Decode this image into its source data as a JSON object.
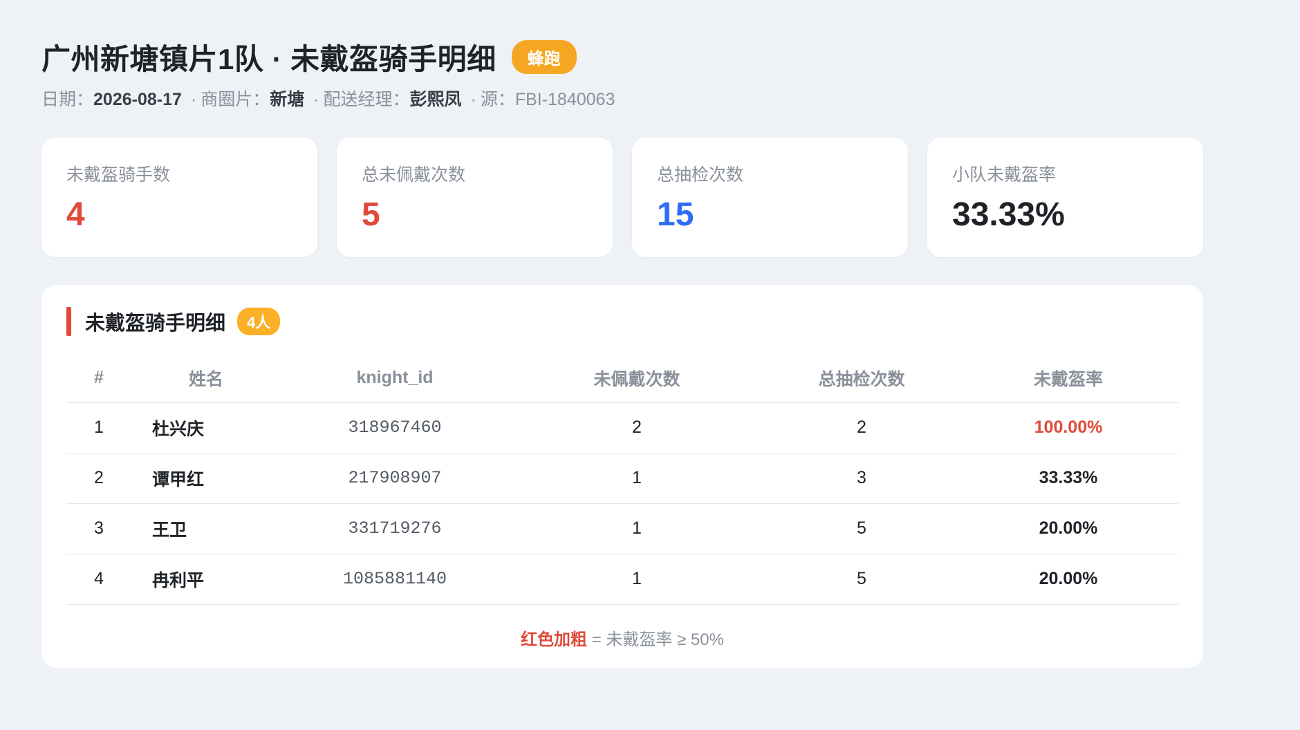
{
  "header": {
    "title": "广州新塘镇片1队 · 未戴盔骑手明细",
    "platform_badge": "蜂跑"
  },
  "meta": {
    "date_label": "日期：",
    "date": "2026-08-17",
    "sep": "·",
    "district_label": "商圈片：",
    "district": "新塘",
    "manager_label": "配送经理：",
    "manager": "彭熙凤",
    "source": "源：FBI-1840063"
  },
  "cards": [
    {
      "label": "未戴盔骑手数",
      "value": "4",
      "color": "#e04a38"
    },
    {
      "label": "总未佩戴次数",
      "value": "5",
      "color": "#e04a38"
    },
    {
      "label": "总抽检次数",
      "value": "15",
      "color": "#2f6df6"
    },
    {
      "label": "小队未戴盔率",
      "value": "33.33%",
      "color": "#1f2328"
    }
  ],
  "panel": {
    "title": "未戴盔骑手明细",
    "count_badge": "4人",
    "accent_color": "#e04a38"
  },
  "table": {
    "headers": [
      "#",
      "姓名",
      "knight_id",
      "未佩戴次数",
      "总抽检次数",
      "未戴盔率"
    ],
    "rows": [
      {
        "idx": "1",
        "name": "杜兴庆",
        "knight_id": "318967460",
        "missed": "2",
        "total": "2",
        "rate": "100.00%",
        "rate_color": "#e04a38"
      },
      {
        "idx": "2",
        "name": "谭甲红",
        "knight_id": "217908907",
        "missed": "1",
        "total": "3",
        "rate": "33.33%",
        "rate_color": "#1f2328"
      },
      {
        "idx": "3",
        "name": "王卫",
        "knight_id": "331719276",
        "missed": "1",
        "total": "5",
        "rate": "20.00%",
        "rate_color": "#1f2328"
      },
      {
        "idx": "4",
        "name": "冉利平",
        "knight_id": "1085881140",
        "missed": "1",
        "total": "5",
        "rate": "20.00%",
        "rate_color": "#1f2328"
      }
    ]
  },
  "legend": {
    "highlight": "红色加粗",
    "text": " = 未戴盔率 ≥ 50%",
    "highlight_color": "#e04a38"
  }
}
